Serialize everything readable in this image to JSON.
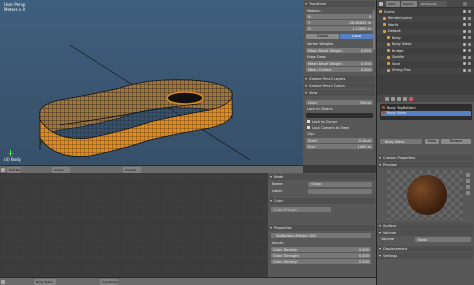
{
  "viewport": {
    "mode_label": "User Persp",
    "meters_label": "Meters x 0",
    "object_label": "(4) Body"
  },
  "properties_n": {
    "transform_header": "Transform",
    "median_label": "Median:",
    "x_label": "X:",
    "x_value": "0",
    "y_label": "Y:",
    "y_value": "-26.65642 m",
    "z_label": "Z:",
    "z_value": "1.12995 m",
    "global_btn": "Global",
    "local_btn": "Local",
    "vertex_weights_label": "Vertex Weights",
    "mean_bevel_weight_label": "Mean Bevel Weight:",
    "mean_bevel_weight_value": "0.000",
    "edge_data_label": "Edge Data:",
    "mean_bevel_weight2_label": "Mean Bevel Weight:",
    "mean_bevel_weight2_value": "0.000",
    "mean_crease_label": "Mean Crease:",
    "mean_crease_value": "0.000",
    "grease_pencil_layers": "Grease Pencil Layers",
    "grease_pencil_colors": "Grease Pencil Colors",
    "view_header": "View",
    "lens_label": "Lens:",
    "lens_value": "35mm",
    "lock_to_object": "Lock to Object:",
    "lock_to_cursor": "Lock to Cursor",
    "lock_camera": "Lock Camera to View",
    "clip_label": "Clip:",
    "start_label": "Start:",
    "start_value": "0.1mm",
    "end_label": "End:",
    "end_value": "1000 m"
  },
  "outliner": {
    "view_tab": "View",
    "search_tab": "Search",
    "scenes_tab": "All Scenes",
    "items": [
      {
        "label": "Scene"
      },
      {
        "label": "RenderLayers"
      },
      {
        "label": "World"
      },
      {
        "label": "Default"
      },
      {
        "label": "Body"
      },
      {
        "label": "Body Sides"
      },
      {
        "label": "Bridge"
      },
      {
        "label": "Saddle"
      },
      {
        "label": "Spot"
      },
      {
        "label": "String Pins"
      }
    ]
  },
  "material_panel": {
    "slot1": "Body TopBottom",
    "slot2": "Body Sides",
    "material_name": "Body Sides",
    "data_btn": "Data",
    "browse_btn": "Browse",
    "custom_properties": "Custom Properties",
    "preview_header": "Preview",
    "surface": "Surface",
    "volume": "Volume",
    "volume_value": "None",
    "displacement": "Displacement",
    "settings": "Settings"
  },
  "node_panel": {
    "node_header": "Node",
    "name_label": "Name:",
    "name_value": "Group",
    "label_label": "Label:",
    "color_header": "Color",
    "color_preset": "Color Presets",
    "properties_header": "Properties",
    "group_name": "TopBottom-Pattern.002",
    "inputs_label": "Inputs:",
    "grain_density_label": "Grain Density:",
    "grain_density_value": "0.500",
    "grain_strength_label": "Grain Strength:",
    "grain_strength_value": "0.500",
    "grain_density2_label": "Grain Density:",
    "grain_density2_value": "0.500"
  },
  "headers": {
    "view_edit_mode": "Edit Mode",
    "view_global": "Global",
    "view_closest": "Closest",
    "node_body_sides": "Body Sides",
    "node_use_nodes": "Use Nodes",
    "bottom_body_sides": "Body Sides"
  },
  "colors": {
    "accent": "#5680c2",
    "wood": "#e08a1c",
    "viewport_bg": "#3f5f7f"
  }
}
